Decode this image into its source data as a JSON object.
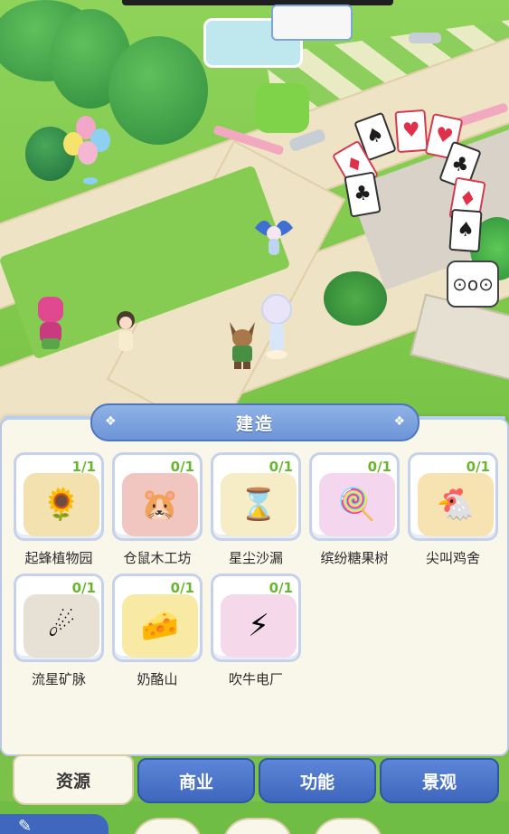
{
  "panel": {
    "title": "建造",
    "items": [
      {
        "name": "起蜂植物园",
        "count": "1/1",
        "icon": "flower-garden-icon",
        "color": "#f3e2b0"
      },
      {
        "name": "仓鼠木工坊",
        "count": "0/1",
        "icon": "hamster-workshop-icon",
        "color": "#f1c6c0"
      },
      {
        "name": "星尘沙漏",
        "count": "0/1",
        "icon": "hourglass-icon",
        "color": "#f6edc6"
      },
      {
        "name": "缤纷糖果树",
        "count": "0/1",
        "icon": "candy-tree-icon",
        "color": "#f4d6ee"
      },
      {
        "name": "尖叫鸡舍",
        "count": "0/1",
        "icon": "chicken-coop-icon",
        "color": "#f7e3b2"
      },
      {
        "name": "流星矿脉",
        "count": "0/1",
        "icon": "meteor-mine-icon",
        "color": "#e6e0d5"
      },
      {
        "name": "奶酪山",
        "count": "0/1",
        "icon": "cheese-mountain-icon",
        "color": "#f8eaa4"
      },
      {
        "name": "吹牛电厂",
        "count": "0/1",
        "icon": "power-plant-icon",
        "color": "#f5d9ea"
      }
    ]
  },
  "tabs": [
    {
      "label": "资源",
      "active": true
    },
    {
      "label": "商业",
      "active": false
    },
    {
      "label": "功能",
      "active": false
    },
    {
      "label": "景观",
      "active": false
    }
  ],
  "scene": {
    "cards": [
      "♠",
      "♥",
      "♥",
      "♦",
      "♣",
      "♣",
      "♦",
      "♠",
      "♥"
    ]
  }
}
